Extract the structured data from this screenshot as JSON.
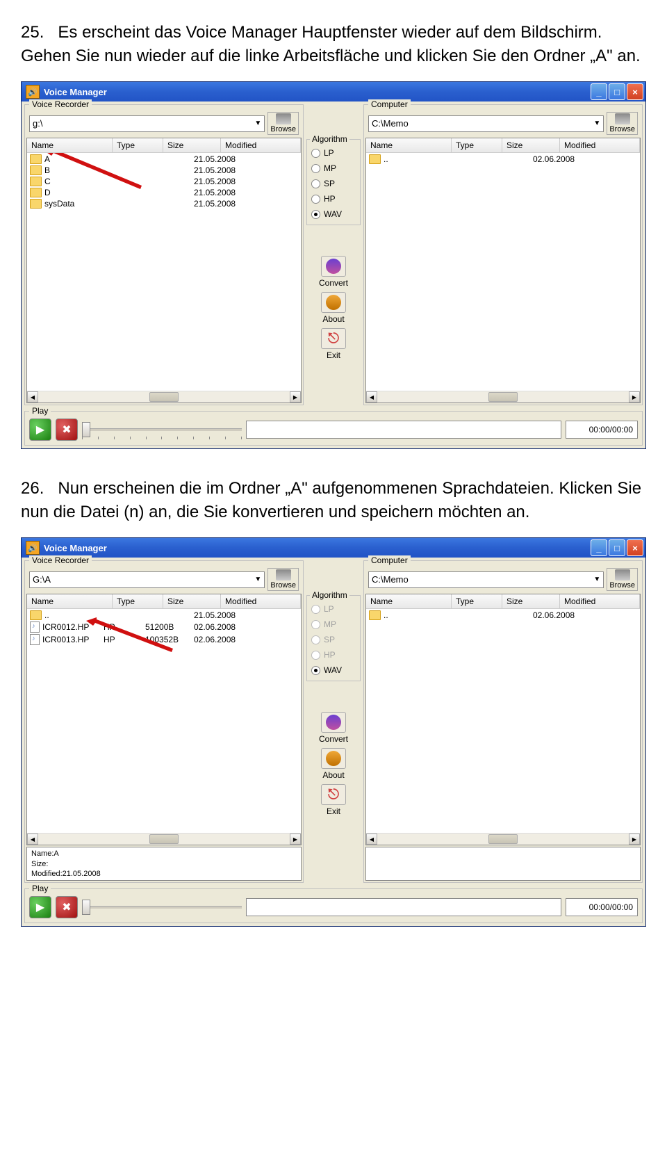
{
  "step25": {
    "num": "25.",
    "text1": "Es erscheint das Voice Manager Hauptfenster wieder auf dem Bildschirm. Gehen Sie nun wieder auf die linke Arbeitsfläche und klicken Sie den Ordner „A\" an."
  },
  "step26": {
    "num": "26.",
    "text1": "Nun erscheinen die im Ordner „A\" aufgenommenen Sprachdateien. Klicken Sie nun  die Datei (n) an, die Sie konvertieren und speichern möchten an."
  },
  "window1": {
    "title": "Voice Manager",
    "recorder_label": "Voice Recorder",
    "computer_label": "Computer",
    "algo_label": "Algorithm",
    "play_label": "Play",
    "browse": "Browse",
    "convert": "Convert",
    "about": "About",
    "exit": "Exit",
    "left_path": "g:\\",
    "right_path": "C:\\Memo",
    "cols": {
      "name": "Name",
      "type": "Type",
      "size": "Size",
      "modified": "Modified"
    },
    "left_rows": [
      {
        "name": "A",
        "type": "",
        "size": "",
        "modified": "21.05.2008"
      },
      {
        "name": "B",
        "type": "",
        "size": "",
        "modified": "21.05.2008"
      },
      {
        "name": "C",
        "type": "",
        "size": "",
        "modified": "21.05.2008"
      },
      {
        "name": "D",
        "type": "",
        "size": "",
        "modified": "21.05.2008"
      },
      {
        "name": "sysData",
        "type": "",
        "size": "",
        "modified": "21.05.2008"
      }
    ],
    "right_rows": [
      {
        "name": "..",
        "type": "",
        "size": "",
        "modified": "02.06.2008"
      }
    ],
    "algos": [
      "LP",
      "MP",
      "SP",
      "HP",
      "WAV"
    ],
    "algo_selected": "WAV",
    "time": "00:00/00:00"
  },
  "window2": {
    "title": "Voice Manager",
    "recorder_label": "Voice Recorder",
    "computer_label": "Computer",
    "algo_label": "Algorithm",
    "play_label": "Play",
    "browse": "Browse",
    "convert": "Convert",
    "about": "About",
    "exit": "Exit",
    "left_path": "G:\\A",
    "right_path": "C:\\Memo",
    "cols": {
      "name": "Name",
      "type": "Type",
      "size": "Size",
      "modified": "Modified"
    },
    "left_rows": [
      {
        "name": "..",
        "type": "",
        "size": "",
        "modified": "21.05.2008",
        "icon": "folder"
      },
      {
        "name": "ICR0012.HP",
        "type": "HP",
        "size": "51200B",
        "modified": "02.06.2008",
        "icon": "file"
      },
      {
        "name": "ICR0013.HP",
        "type": "HP",
        "size": "100352B",
        "modified": "02.06.2008",
        "icon": "file"
      }
    ],
    "right_rows": [
      {
        "name": "..",
        "type": "",
        "size": "",
        "modified": "02.06.2008"
      }
    ],
    "algos": [
      "LP",
      "MP",
      "SP",
      "HP",
      "WAV"
    ],
    "algo_selected": "WAV",
    "algo_disabled": [
      "LP",
      "MP",
      "SP",
      "HP"
    ],
    "time": "00:00/00:00",
    "info": {
      "l1": "Name:A",
      "l2": "Size:",
      "l3": "Modified:21.05.2008"
    }
  }
}
